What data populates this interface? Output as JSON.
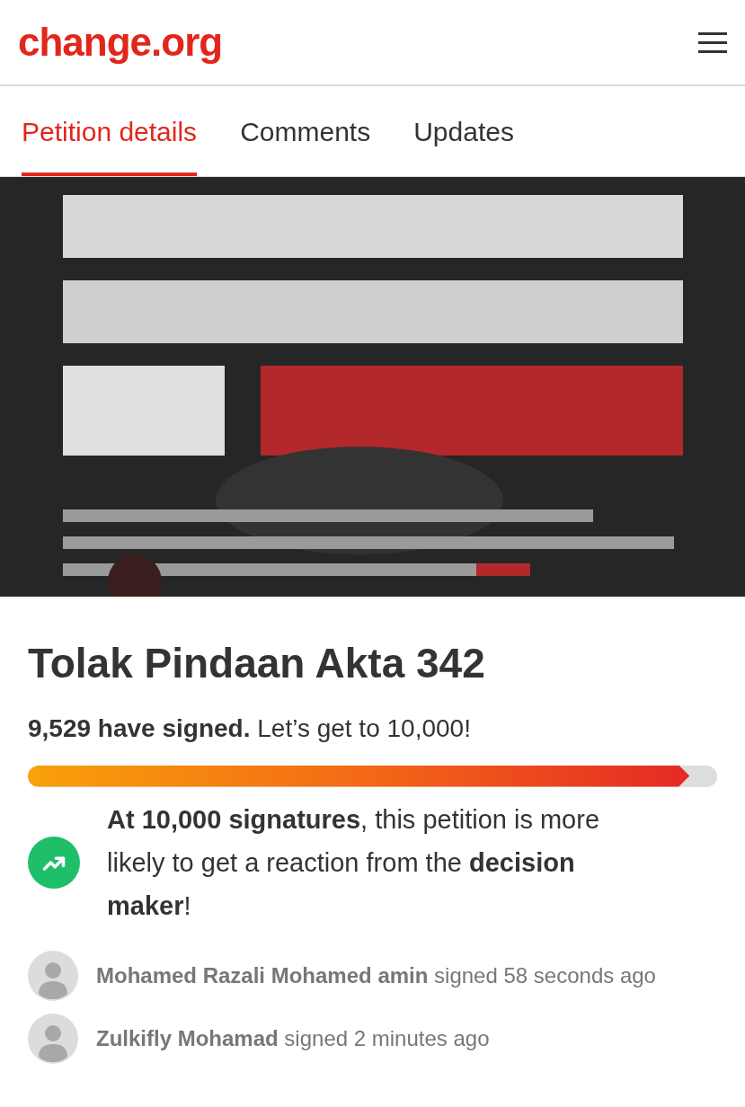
{
  "header": {
    "logo": "change.org"
  },
  "tabs": [
    {
      "label": "Petition details",
      "selected": true
    },
    {
      "label": "Comments",
      "selected": false
    },
    {
      "label": "Updates",
      "selected": false
    }
  ],
  "petition": {
    "title": "Tolak Pindaan Akta 342",
    "signed_count": "9,529 have signed.",
    "goal_text": "Let’s get to 10,000!",
    "progress": {
      "level": 0.96
    },
    "milestone": "**At 10,000 signatures**, this petition is more likely to get a reaction from the **decision maker**!"
  },
  "recent_signers": [
    {
      "name": "Mohamed Razali Mohamed amin",
      "action": "signed 58 seconds ago"
    },
    {
      "name": "Zulkifly Mohamad",
      "action": "signed 2 minutes ago"
    }
  ]
}
